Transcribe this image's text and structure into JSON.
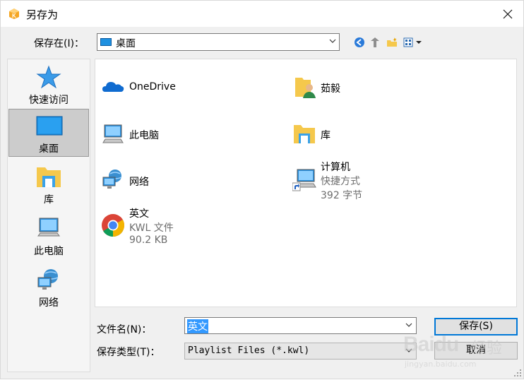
{
  "window": {
    "title": "另存为"
  },
  "toolbar": {
    "save_in_label": "保存在(I)：",
    "save_in_value": "桌面"
  },
  "places": [
    {
      "name": "quick-access",
      "label": "快速访问",
      "icon": "star-icon"
    },
    {
      "name": "desktop",
      "label": "桌面",
      "icon": "desktop-icon",
      "selected": true
    },
    {
      "name": "libraries",
      "label": "库",
      "icon": "library-folder-icon"
    },
    {
      "name": "this-pc",
      "label": "此电脑",
      "icon": "computer-icon"
    },
    {
      "name": "network",
      "label": "网络",
      "icon": "network-icon"
    }
  ],
  "files": [
    {
      "name": "OneDrive",
      "icon": "onedrive-cloud-icon"
    },
    {
      "name": "茹毅",
      "icon": "user-folder-icon"
    },
    {
      "name": "此电脑",
      "icon": "computer-icon"
    },
    {
      "name": "库",
      "icon": "library-folder-icon"
    },
    {
      "name": "网络",
      "icon": "network-icon"
    },
    {
      "name": "计算机",
      "type": "快捷方式",
      "size": "392 字节",
      "icon": "computer-shortcut-icon"
    },
    {
      "name": "英文",
      "type": "KWL 文件",
      "size": "90.2 KB",
      "icon": "chrome-icon"
    }
  ],
  "bottom": {
    "filename_label": "文件名(N)：",
    "filename_value": "英文",
    "filetype_label": "保存类型(T)：",
    "filetype_value": "Playlist Files (*.kwl)",
    "save_button": "保存(S)",
    "cancel_button": "取消"
  },
  "watermark": {
    "brand": "Baidu",
    "product": "经验",
    "url": "jingyan.baidu.com"
  },
  "colors": {
    "selection": "#3399ff",
    "default_button_border": "#0078d7",
    "folder": "#f5c84c",
    "accent_blue": "#1e90e0"
  }
}
